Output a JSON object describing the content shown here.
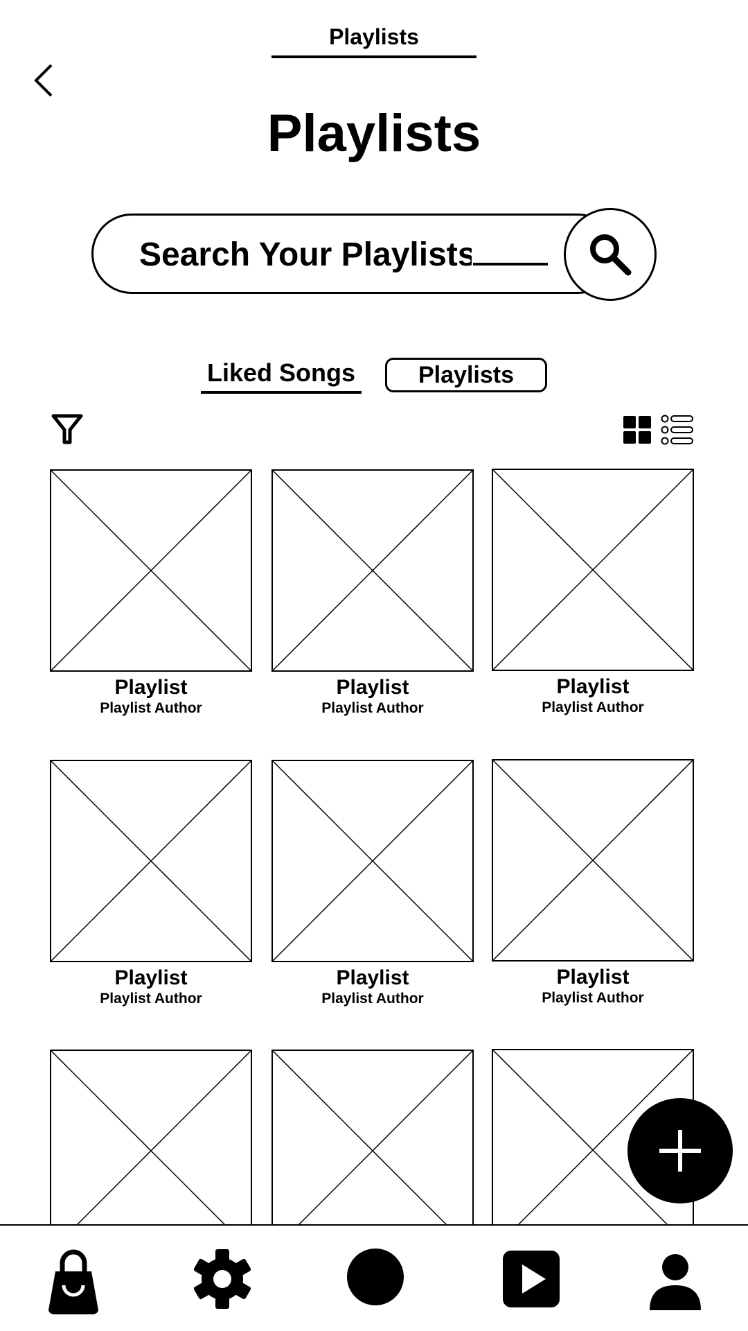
{
  "header": {
    "top_tab_label": "Playlists",
    "page_title": "Playlists"
  },
  "search": {
    "placeholder": "Search Your Playlists"
  },
  "tabs": [
    {
      "label": "Liked Songs",
      "active": false
    },
    {
      "label": "Playlists",
      "active": true
    }
  ],
  "toolbar": {
    "filter_icon": "filter-icon",
    "grid_view_icon": "grid-view-icon",
    "list_view_icon": "list-view-icon"
  },
  "playlists": [
    {
      "title": "Playlist",
      "author": "Playlist Author"
    },
    {
      "title": "Playlist",
      "author": "Playlist Author"
    },
    {
      "title": "Playlist",
      "author": "Playlist Author"
    },
    {
      "title": "Playlist",
      "author": "Playlist Author"
    },
    {
      "title": "Playlist",
      "author": "Playlist Author"
    },
    {
      "title": "Playlist",
      "author": "Playlist Author"
    }
  ],
  "fab": {
    "icon": "plus-icon"
  },
  "bottom_nav": [
    {
      "icon": "shopping-bag-icon"
    },
    {
      "icon": "gear-icon"
    },
    {
      "icon": "circle-icon"
    },
    {
      "icon": "play-icon"
    },
    {
      "icon": "user-icon"
    }
  ],
  "colors": {
    "foreground": "#000000",
    "background": "#ffffff"
  }
}
